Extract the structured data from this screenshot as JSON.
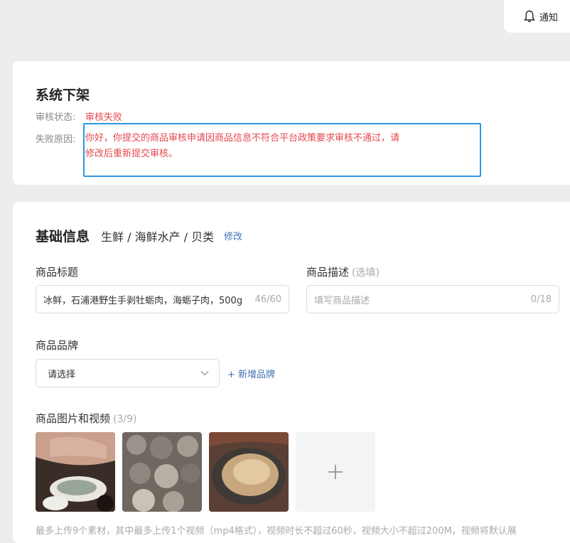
{
  "header": {
    "notify_label": "通知"
  },
  "status_card": {
    "title": "系统下架",
    "status_label": "审核状态:",
    "status_value": "审核失败",
    "reason_label": "失败原因:",
    "reason_line1": "你好，你提交的商品审核申请因商品信息不符合平台政策要求审核不通过，请",
    "reason_line2": "修改后重新提交审核。"
  },
  "basic_info": {
    "title": "基础信息",
    "category": "生鲜 / 海鲜水产 / 贝类",
    "edit_label": "修改",
    "product_title": {
      "label": "商品标题",
      "value": "冰鲜，石浦港野生手剥牡蛎肉，海蛎子肉，500g",
      "count": "46/60"
    },
    "product_desc": {
      "label": "商品描述",
      "optional": "(选填)",
      "placeholder": "填写商品描述",
      "count": "0/18"
    },
    "brand": {
      "label": "商品品牌",
      "selected": "请选择",
      "add_label": "+ 新增品牌"
    },
    "media": {
      "label": "商品图片和视频",
      "count": "(3/9)",
      "images": [
        "oyster-in-hand-image",
        "shucked-oysters-image",
        "oyster-closeup-image"
      ],
      "hint": "最多上传9个素材，其中最多上传1个视频（mp4格式），视频时长不超过60秒，视频大小不超过200M，视频将默认展"
    }
  }
}
